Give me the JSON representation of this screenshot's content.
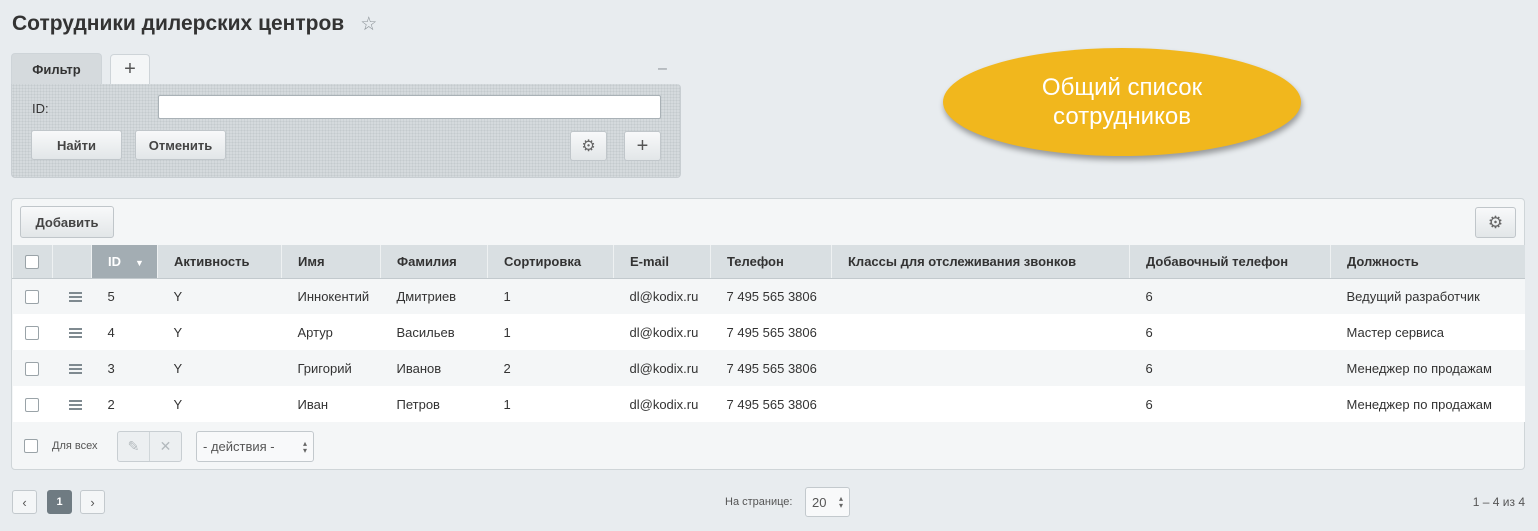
{
  "page": {
    "title": "Сотрудники дилерских центров",
    "star_icon": "star-icon"
  },
  "filter": {
    "tab_label": "Фильтр",
    "add_tab_icon": "+",
    "minimize_icon": "–",
    "id_label": "ID:",
    "id_value": "",
    "find_label": "Найти",
    "cancel_label": "Отменить",
    "gear_icon": "⚙",
    "add_field_icon": "+"
  },
  "callout": {
    "text": "Общий список сотрудников",
    "color": "#f1b71d"
  },
  "grid": {
    "add_label": "Добавить",
    "gear_icon": "⚙",
    "columns": [
      "ID",
      "Активность",
      "Имя",
      "Фамилия",
      "Сортировка",
      "E-mail",
      "Телефон",
      "Классы для отслеживания звонков",
      "Добавочный телефон",
      "Должность"
    ],
    "sort_icon": "▼",
    "rows": [
      {
        "id": "5",
        "active": "Y",
        "name": "Иннокентий",
        "surname": "Дмитриев",
        "sort": "1",
        "email": "dl@kodix.ru",
        "phone": "7 495 565 3806",
        "call_classes": "",
        "ext_phone": "6",
        "position": "Ведущий разработчик"
      },
      {
        "id": "4",
        "active": "Y",
        "name": "Артур",
        "surname": "Васильев",
        "sort": "1",
        "email": "dl@kodix.ru",
        "phone": "7 495 565 3806",
        "call_classes": "",
        "ext_phone": "6",
        "position": "Мастер сервиса"
      },
      {
        "id": "3",
        "active": "Y",
        "name": "Григорий",
        "surname": "Иванов",
        "sort": "2",
        "email": "dl@kodix.ru",
        "phone": "7 495 565 3806",
        "call_classes": "",
        "ext_phone": "6",
        "position": "Менеджер по продажам"
      },
      {
        "id": "2",
        "active": "Y",
        "name": "Иван",
        "surname": "Петров",
        "sort": "1",
        "email": "dl@kodix.ru",
        "phone": "7 495 565 3806",
        "call_classes": "",
        "ext_phone": "6",
        "position": "Менеджер по продажам"
      }
    ],
    "footer": {
      "for_all_label": "Для всех",
      "edit_icon": "✎",
      "delete_icon": "✕",
      "actions_value": "- действия -"
    }
  },
  "pagination": {
    "prev_icon": "‹",
    "current_page": "1",
    "next_icon": "›",
    "per_page_label": "На странице:",
    "per_page_value": "20",
    "total": "1 – 4 из 4"
  }
}
